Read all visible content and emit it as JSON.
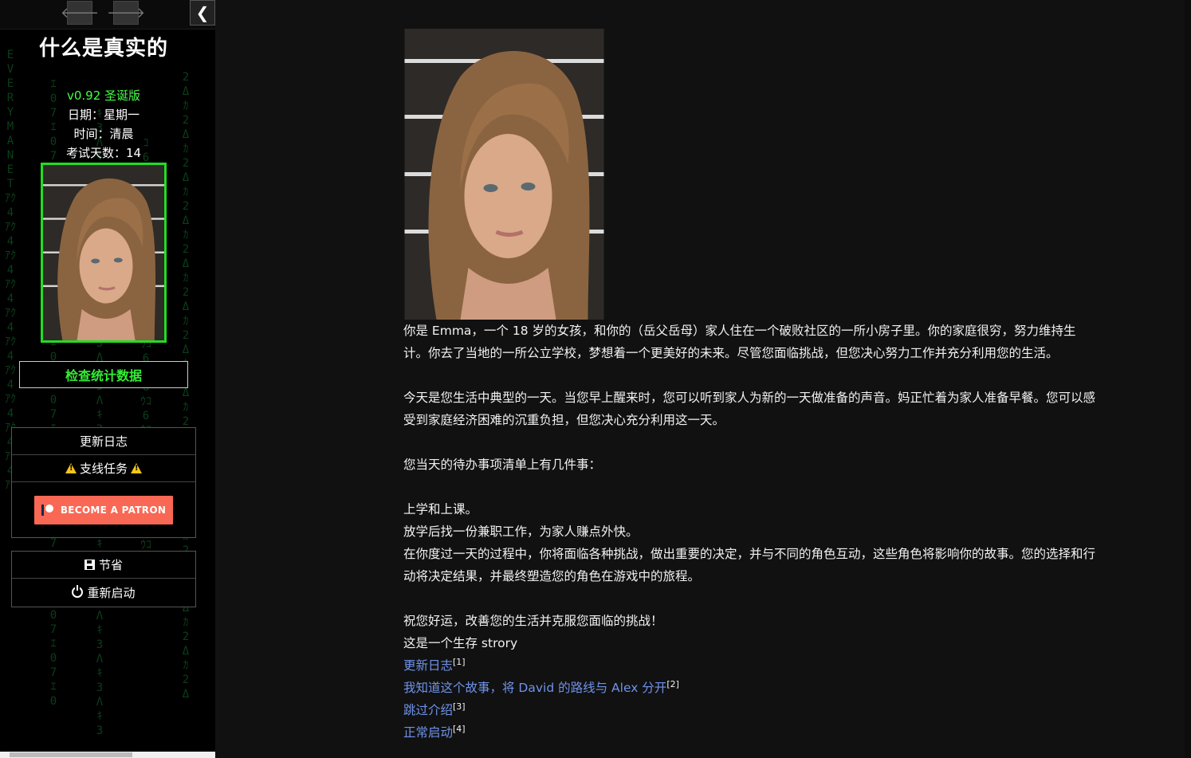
{
  "nav": {
    "back_icon": "arrow-left-icon",
    "forward_icon": "arrow-right-icon",
    "collapse_icon": "chevron-left-icon",
    "back_glyph": "🡐",
    "forward_glyph": "🡒",
    "collapse_glyph": "❮"
  },
  "sidebar": {
    "title": "什么是真实的",
    "version": "v0.92 圣诞版",
    "day": "日期：星期一",
    "time": "时间：清晨",
    "exam_days": "考试天数：14",
    "stats_button": "检查统计数据",
    "menu_top": {
      "changelog": "更新日志",
      "side_quests": "支线任务",
      "patron_button": "BECOME A PATRON"
    },
    "menu_bottom": {
      "save": "节省",
      "restart": "重新启动"
    },
    "matrix_rain_text": "EVERY MAN ET"
  },
  "passage": {
    "paragraphs": [
      "你是 Emma，一个 18 岁的女孩，和你的（岳父岳母）家人住在一个破败社区的一所小房子里。你的家庭很穷，努力维持生计。你去了当地的一所公立学校，梦想着一个更美好的未来。尽管您面临挑战，但您决心努力工作并充分利用您的生活。",
      "今天是您生活中典型的一天。当您早上醒来时，您可以听到家人为新的一天做准备的声音。妈正忙着为家人准备早餐。您可以感受到家庭经济困难的沉重负担，但您决心充分利用这一天。",
      "您当天的待办事项清单上有几件事：",
      "上学和上课。",
      "放学后找一份兼职工作，为家人赚点外快。",
      "在你度过一天的过程中，你将面临各种挑战，做出重要的决定，并与不同的角色互动，这些角色将影响你的故事。您的选择和行动将决定结果，并最终塑造您的角色在游戏中的旅程。",
      "祝您好运，改善您的生活并克服您面临的挑战！",
      "这是一个生存 strory"
    ],
    "links": [
      {
        "label": "更新日志",
        "note": "[1]"
      },
      {
        "label": "我知道这个故事，将 David 的路线与 Alex 分开",
        "note": "[2]"
      },
      {
        "label": "跳过介绍",
        "note": "[3]"
      },
      {
        "label": "正常启动",
        "note": "[4]"
      }
    ]
  },
  "colors": {
    "accent_green": "#22dd22",
    "link_blue": "#6f93ea",
    "patreon": "#f96854"
  }
}
